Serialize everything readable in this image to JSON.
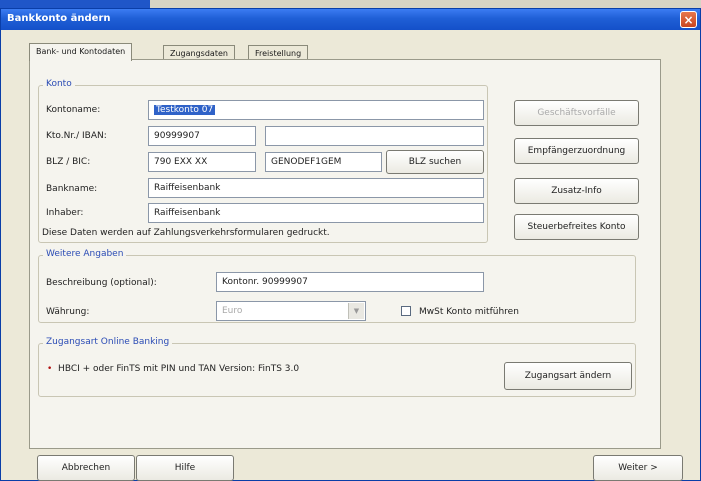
{
  "window": {
    "title": "Bankkonto ändern",
    "close_label": "×"
  },
  "tabs": [
    {
      "label": "Bank- und Kontodaten"
    },
    {
      "label": "Zugangsdaten"
    },
    {
      "label": "Freistellung"
    }
  ],
  "konto": {
    "legend": "Konto",
    "kontoname_label": "Kontoname:",
    "kontoname_value": "Testkonto 07",
    "ktonr_label": "Kto.Nr./ IBAN:",
    "ktonr_value": "90999907",
    "iban_value": "",
    "blz_label": "BLZ / BIC:",
    "blz_value": "790 EXX XX",
    "bic_value": "GENODEF1GEM",
    "blz_search_label": "BLZ suchen",
    "bankname_label": "Bankname:",
    "bankname_value": "Raiffeisenbank",
    "inhaber_label": "Inhaber:",
    "inhaber_value": "Raiffeisenbank",
    "note": "Diese Daten werden auf Zahlungsverkehrsformularen gedruckt."
  },
  "side_buttons": {
    "geschaeftsvorfaelle": "Geschäftsvorfälle",
    "empfaenger": "Empfängerzuordnung",
    "zusatz": "Zusatz-Info",
    "steuerbefreit": "Steuerbefreites Konto"
  },
  "weitere": {
    "legend": "Weitere Angaben",
    "beschreibung_label": "Beschreibung (optional):",
    "beschreibung_value": "Kontonr. 90999907",
    "waehrung_label": "Währung:",
    "waehrung_value": "Euro",
    "mwst_label": "MwSt Konto mitführen",
    "mwst_checked": false
  },
  "zugangsart": {
    "legend": "Zugangsart Online Banking",
    "bullet": "•",
    "text": "HBCI + oder FinTS mit PIN und TAN   Version: FinTS 3.0",
    "change_label": "Zugangsart ändern"
  },
  "footer": {
    "abbrechen": "Abbrechen",
    "hilfe": "Hilfe",
    "weiter": "Weiter >"
  }
}
